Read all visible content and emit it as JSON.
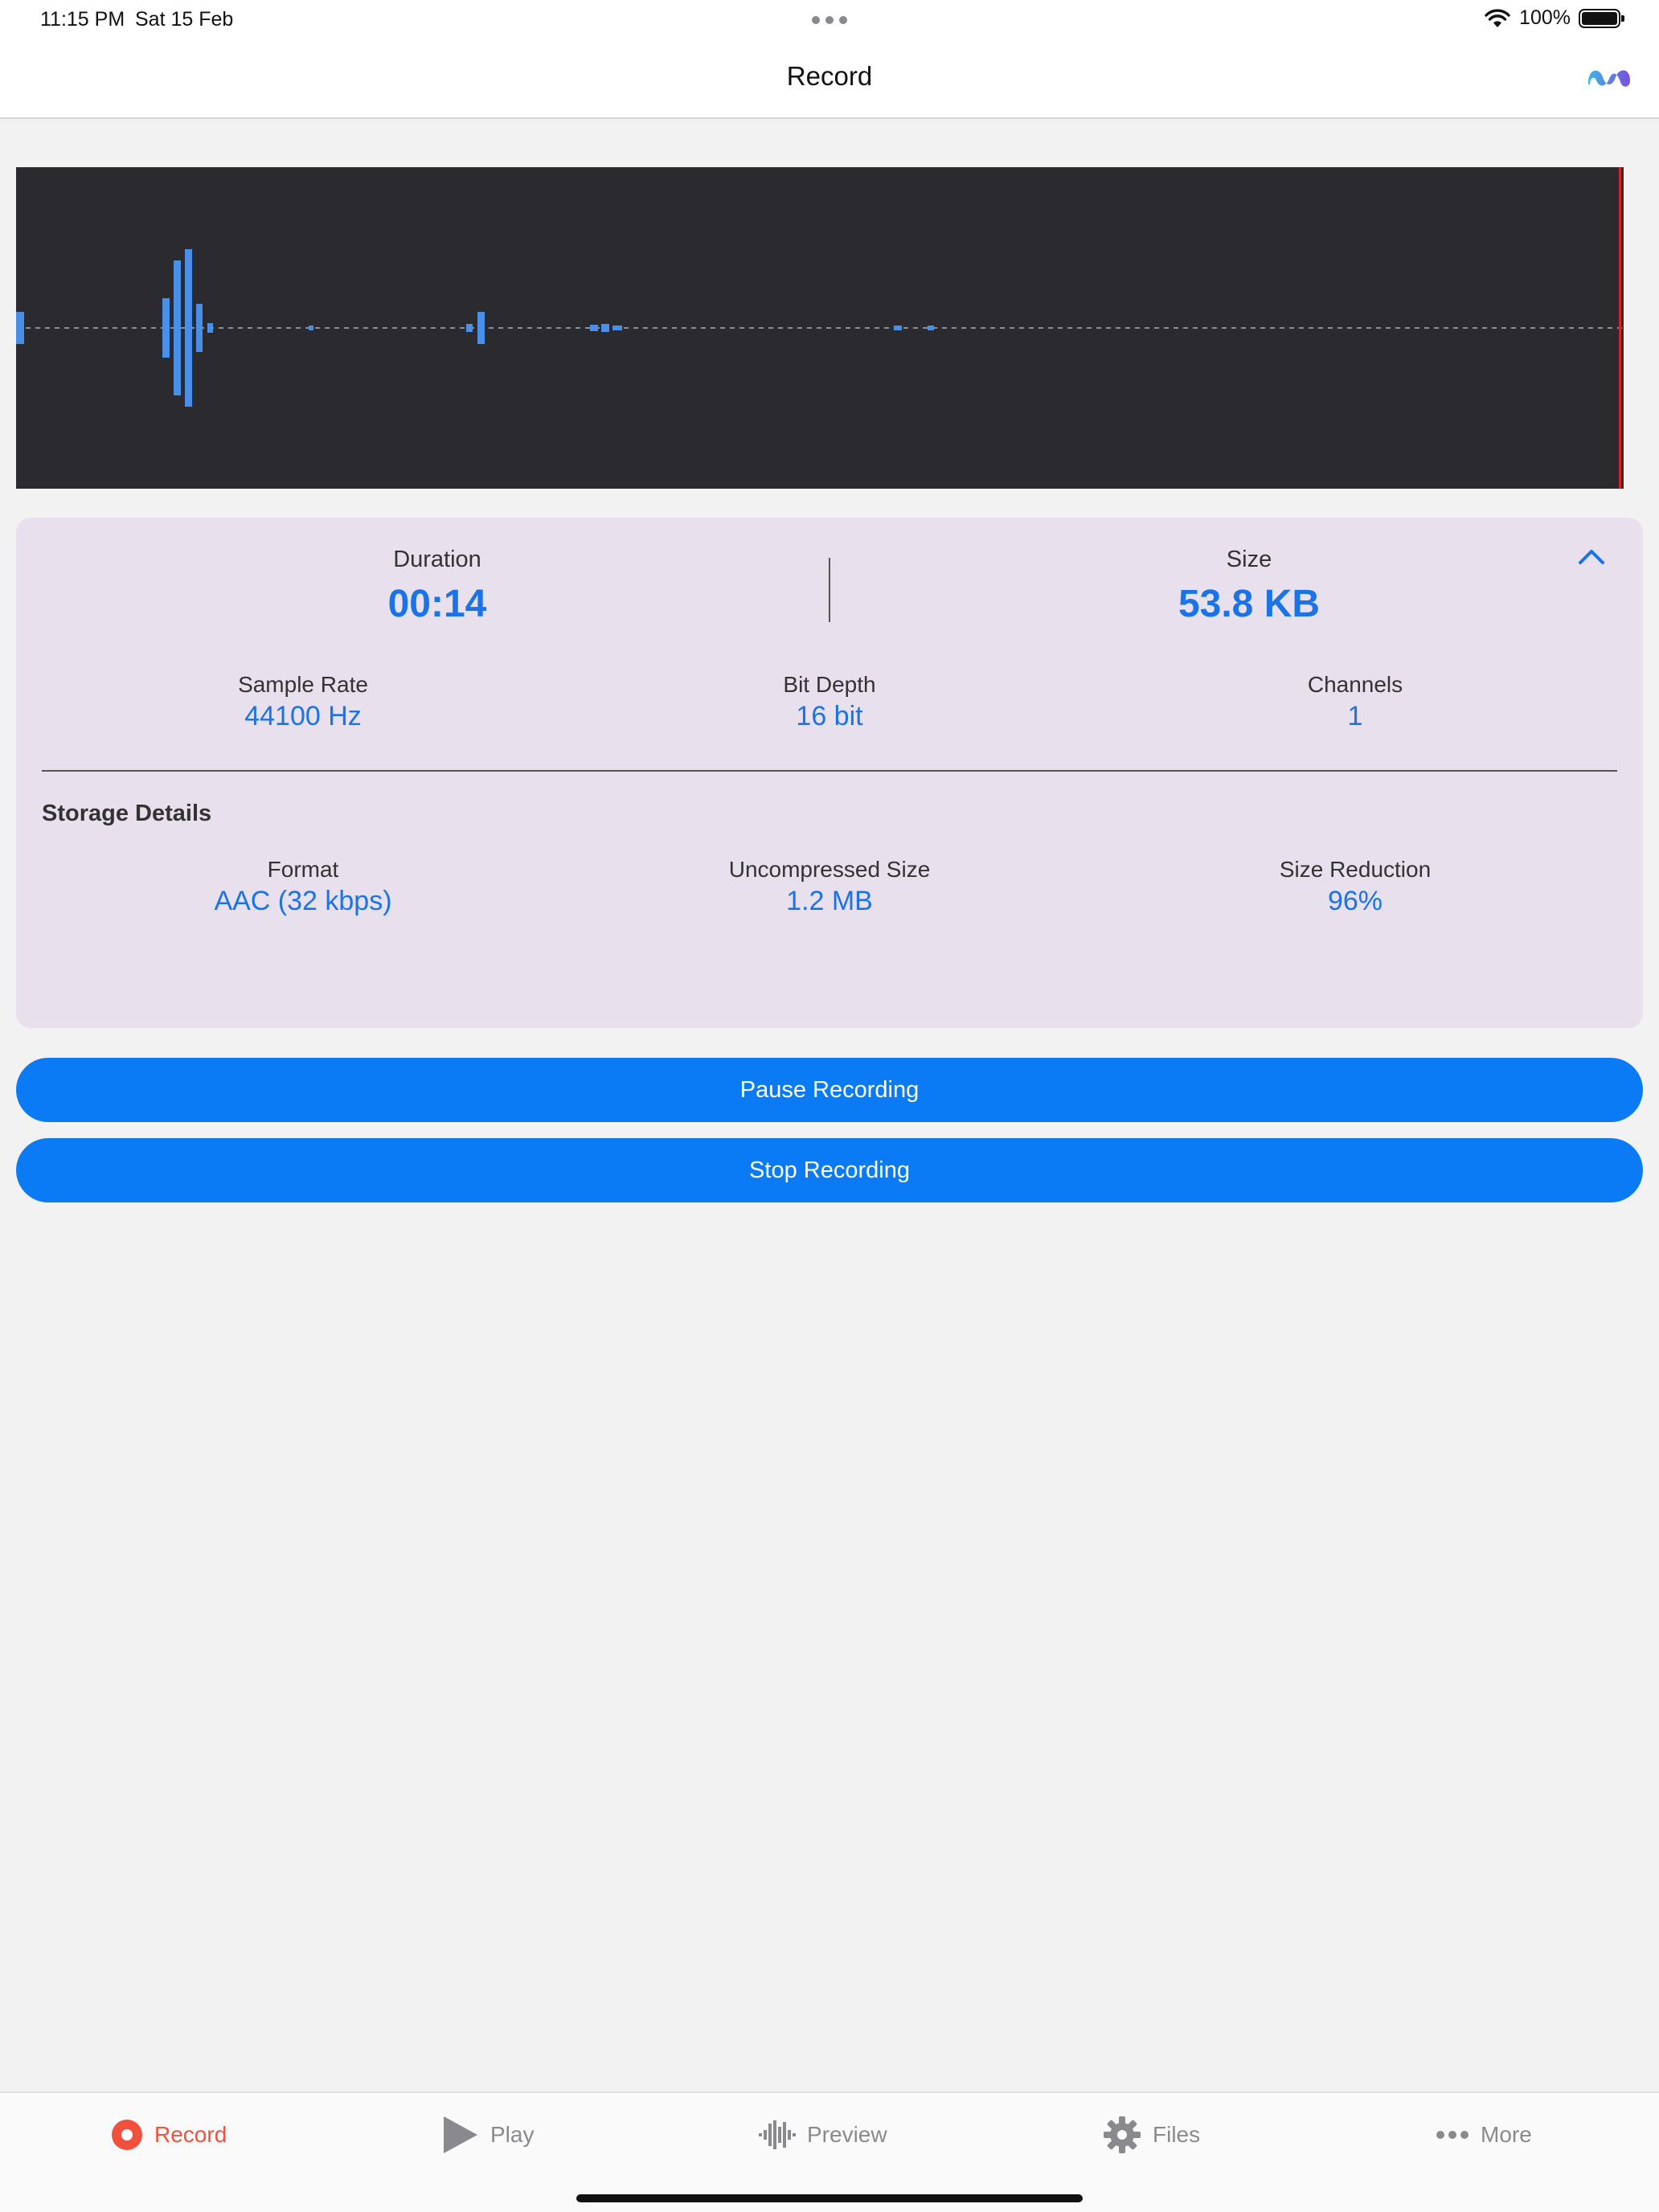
{
  "status_bar": {
    "time": "11:15 PM",
    "date": "Sat 15 Feb",
    "battery": "100%"
  },
  "nav": {
    "title": "Record",
    "logo_icon": "app-logo-icon"
  },
  "waveform": {
    "background": "#2a2a2f",
    "bar_color": "#4a8fe7",
    "playhead_color": "#e02020"
  },
  "stats": {
    "duration_label": "Duration",
    "duration_value": "00:14",
    "size_label": "Size",
    "size_value": "53.8 KB",
    "sample_rate_label": "Sample Rate",
    "sample_rate_value": "44100 Hz",
    "bit_depth_label": "Bit Depth",
    "bit_depth_value": "16 bit",
    "channels_label": "Channels",
    "channels_value": "1",
    "storage_title": "Storage Details",
    "format_label": "Format",
    "format_value": "AAC (32 kbps)",
    "uncompressed_label": "Uncompressed Size",
    "uncompressed_value": "1.2 MB",
    "reduction_label": "Size Reduction",
    "reduction_value": "96%",
    "accent_color": "#1a73e8",
    "panel_color": "#e8e0ec"
  },
  "buttons": {
    "pause_label": "Pause Recording",
    "stop_label": "Stop Recording",
    "color": "#0a7bf5"
  },
  "tabs": [
    {
      "label": "Record",
      "icon": "record-icon",
      "active": true
    },
    {
      "label": "Play",
      "icon": "play-icon",
      "active": false
    },
    {
      "label": "Preview",
      "icon": "waveform-icon",
      "active": false
    },
    {
      "label": "Files",
      "icon": "gear-icon",
      "active": false
    },
    {
      "label": "More",
      "icon": "more-dots-icon",
      "active": false
    }
  ]
}
